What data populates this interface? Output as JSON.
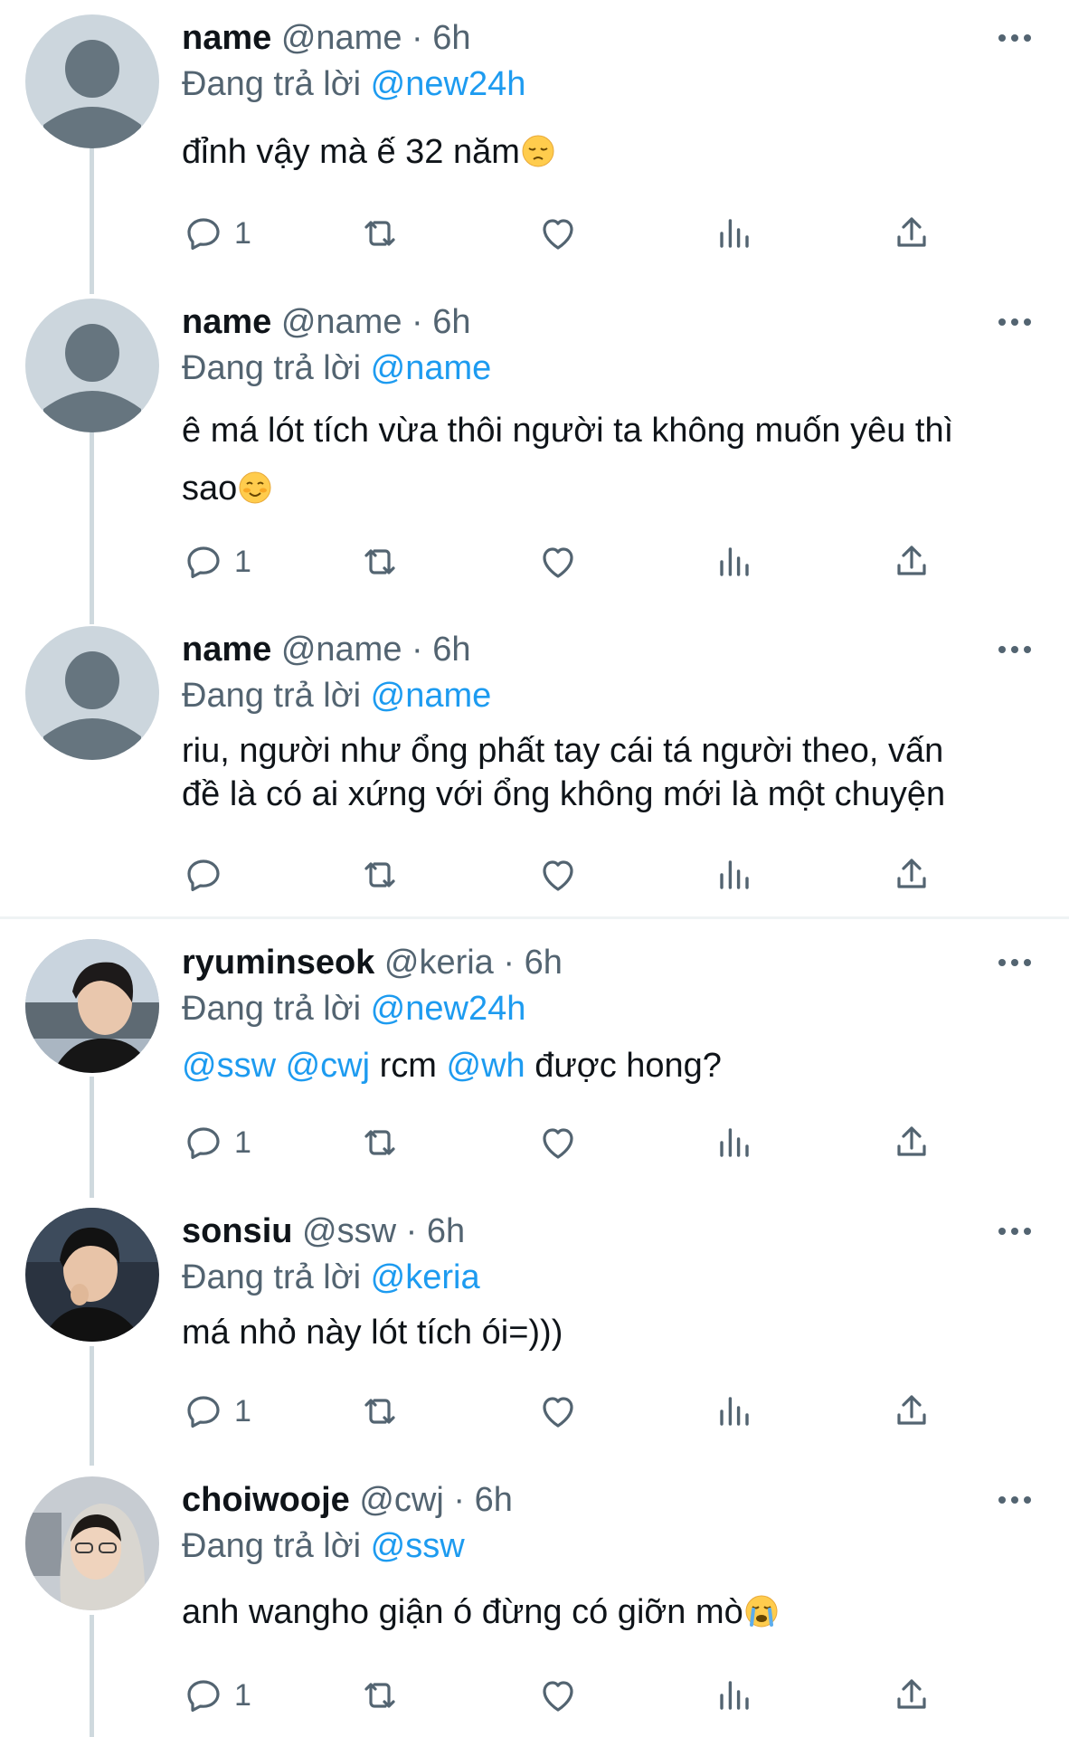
{
  "reply_prefix": "Đang trả lời",
  "tweets": [
    {
      "name": "name",
      "handle": "@name · 6h",
      "reply_to": "@new24h",
      "text": "đỉnh vậy mà ế 32 năm",
      "emoji": "pensive-face",
      "reply_count": "1"
    },
    {
      "name": "name",
      "handle": "@name · 6h",
      "reply_to": "@name",
      "text_line1": "ê má lót tích vừa thôi người ta không muốn yêu thì",
      "text_line2": "sao",
      "emoji": "smiling-face",
      "reply_count": "1"
    },
    {
      "name": "name",
      "handle": "@name · 6h",
      "reply_to": "@name",
      "text_line1": "riu, người như ổng phất tay cái tá người theo, vấn",
      "text_line2": "đề là có ai xứng với ổng không mới là một chuyện",
      "reply_count": ""
    },
    {
      "name": "ryuminseok",
      "handle": "@keria · 6h",
      "reply_to": "@new24h",
      "mention1": "@ssw",
      "mention2": "@cwj",
      "word_rcm": "rcm",
      "mention3": "@wh",
      "text_tail": "được hong?",
      "reply_count": "1"
    },
    {
      "name": "sonsiu",
      "handle": "@ssw · 6h",
      "reply_to": "@keria",
      "text": "má nhỏ này lót tích ói=)))",
      "reply_count": "1"
    },
    {
      "name": "choiwooje",
      "handle": "@cwj · 6h",
      "reply_to": "@ssw",
      "text": "anh wangho giận ó đừng có giỡn mò",
      "emoji": "loudly-crying-face",
      "reply_count": "1"
    }
  ],
  "colors": {
    "accent": "#1d9bf0",
    "secondary_text": "#536471",
    "thread_line": "#cfd9de",
    "placeholder_avatar": "#ccd6dd"
  }
}
